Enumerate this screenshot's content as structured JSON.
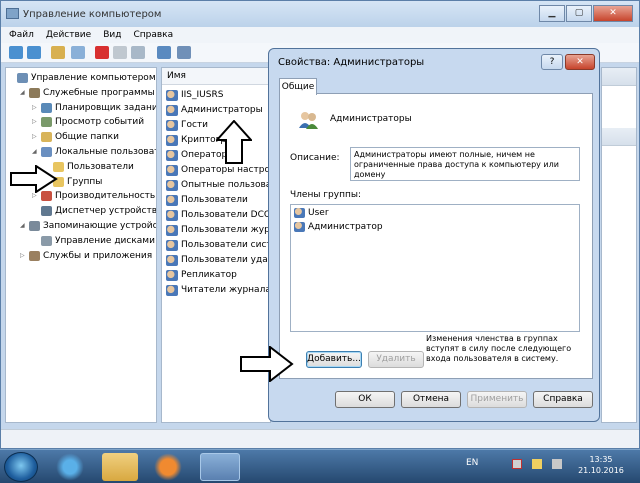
{
  "window": {
    "title": "Управление компьютером"
  },
  "menu": [
    "Файл",
    "Действие",
    "Вид",
    "Справка"
  ],
  "tree": [
    {
      "label": "Управление компьютером (л",
      "indent": 0,
      "expand": "",
      "icon": "computer-icon",
      "color": "#6d8fb5"
    },
    {
      "label": "Служебные программы",
      "indent": 1,
      "expand": "◢",
      "icon": "tools-icon",
      "color": "#8c7a5a"
    },
    {
      "label": "Планировщик заданий",
      "indent": 2,
      "expand": "▷",
      "icon": "clock-icon",
      "color": "#5a8ab8"
    },
    {
      "label": "Просмотр событий",
      "indent": 2,
      "expand": "▷",
      "icon": "event-viewer-icon",
      "color": "#7a9a6a"
    },
    {
      "label": "Общие папки",
      "indent": 2,
      "expand": "▷",
      "icon": "shared-folder-icon",
      "color": "#d8b45a"
    },
    {
      "label": "Локальные пользовате",
      "indent": 2,
      "expand": "◢",
      "icon": "users-icon",
      "color": "#6a8fc0"
    },
    {
      "label": "Пользователи",
      "indent": 3,
      "expand": "",
      "icon": "folder-icon",
      "color": "#e8c560"
    },
    {
      "label": "Группы",
      "indent": 3,
      "expand": "",
      "icon": "folder-icon",
      "color": "#e8c560"
    },
    {
      "label": "Производительность",
      "indent": 2,
      "expand": "▷",
      "icon": "performance-icon",
      "color": "#c85040"
    },
    {
      "label": "Диспетчер устройств",
      "indent": 2,
      "expand": "",
      "icon": "device-manager-icon",
      "color": "#607890"
    },
    {
      "label": "Запоминающие устройст",
      "indent": 1,
      "expand": "◢",
      "icon": "storage-icon",
      "color": "#7a8a9a"
    },
    {
      "label": "Управление дисками",
      "indent": 2,
      "expand": "",
      "icon": "disk-icon",
      "color": "#8a9aa8"
    },
    {
      "label": "Службы и приложения",
      "indent": 1,
      "expand": "▷",
      "icon": "services-icon",
      "color": "#9a8060"
    }
  ],
  "list": {
    "header": "Имя",
    "items": [
      "IIS_IUSRS",
      "Администраторы",
      "Гости",
      "Криптогр",
      "Операторы",
      "Операторы настрой",
      "Опытные пользоват",
      "Пользователи",
      "Пользователи DCOM",
      "Пользователи журн",
      "Пользователи систе",
      "Пользователи удале",
      "Репликатор",
      "Читатели журнала с"
    ]
  },
  "dialog": {
    "title": "Свойства: Администраторы",
    "help": "?",
    "close": "✕",
    "tab": "Общие",
    "group_name": "Администраторы",
    "description_label": "Описание:",
    "description": "Администраторы имеют полные, ничем не ограниченные права доступа к компьютеру или домену",
    "members_label": "Члены группы:",
    "members": [
      "User",
      "Администратор"
    ],
    "add_button": "Добавить...",
    "remove_button": "Удалить",
    "note": "Изменения членства в группах вступят в силу после следующего входа пользователя в систему.",
    "ok": "ОК",
    "cancel": "Отмена",
    "apply": "Применить",
    "help_button": "Справка"
  },
  "taskbar": {
    "lang": "EN",
    "time": "13:35",
    "date": "21.10.2016"
  }
}
